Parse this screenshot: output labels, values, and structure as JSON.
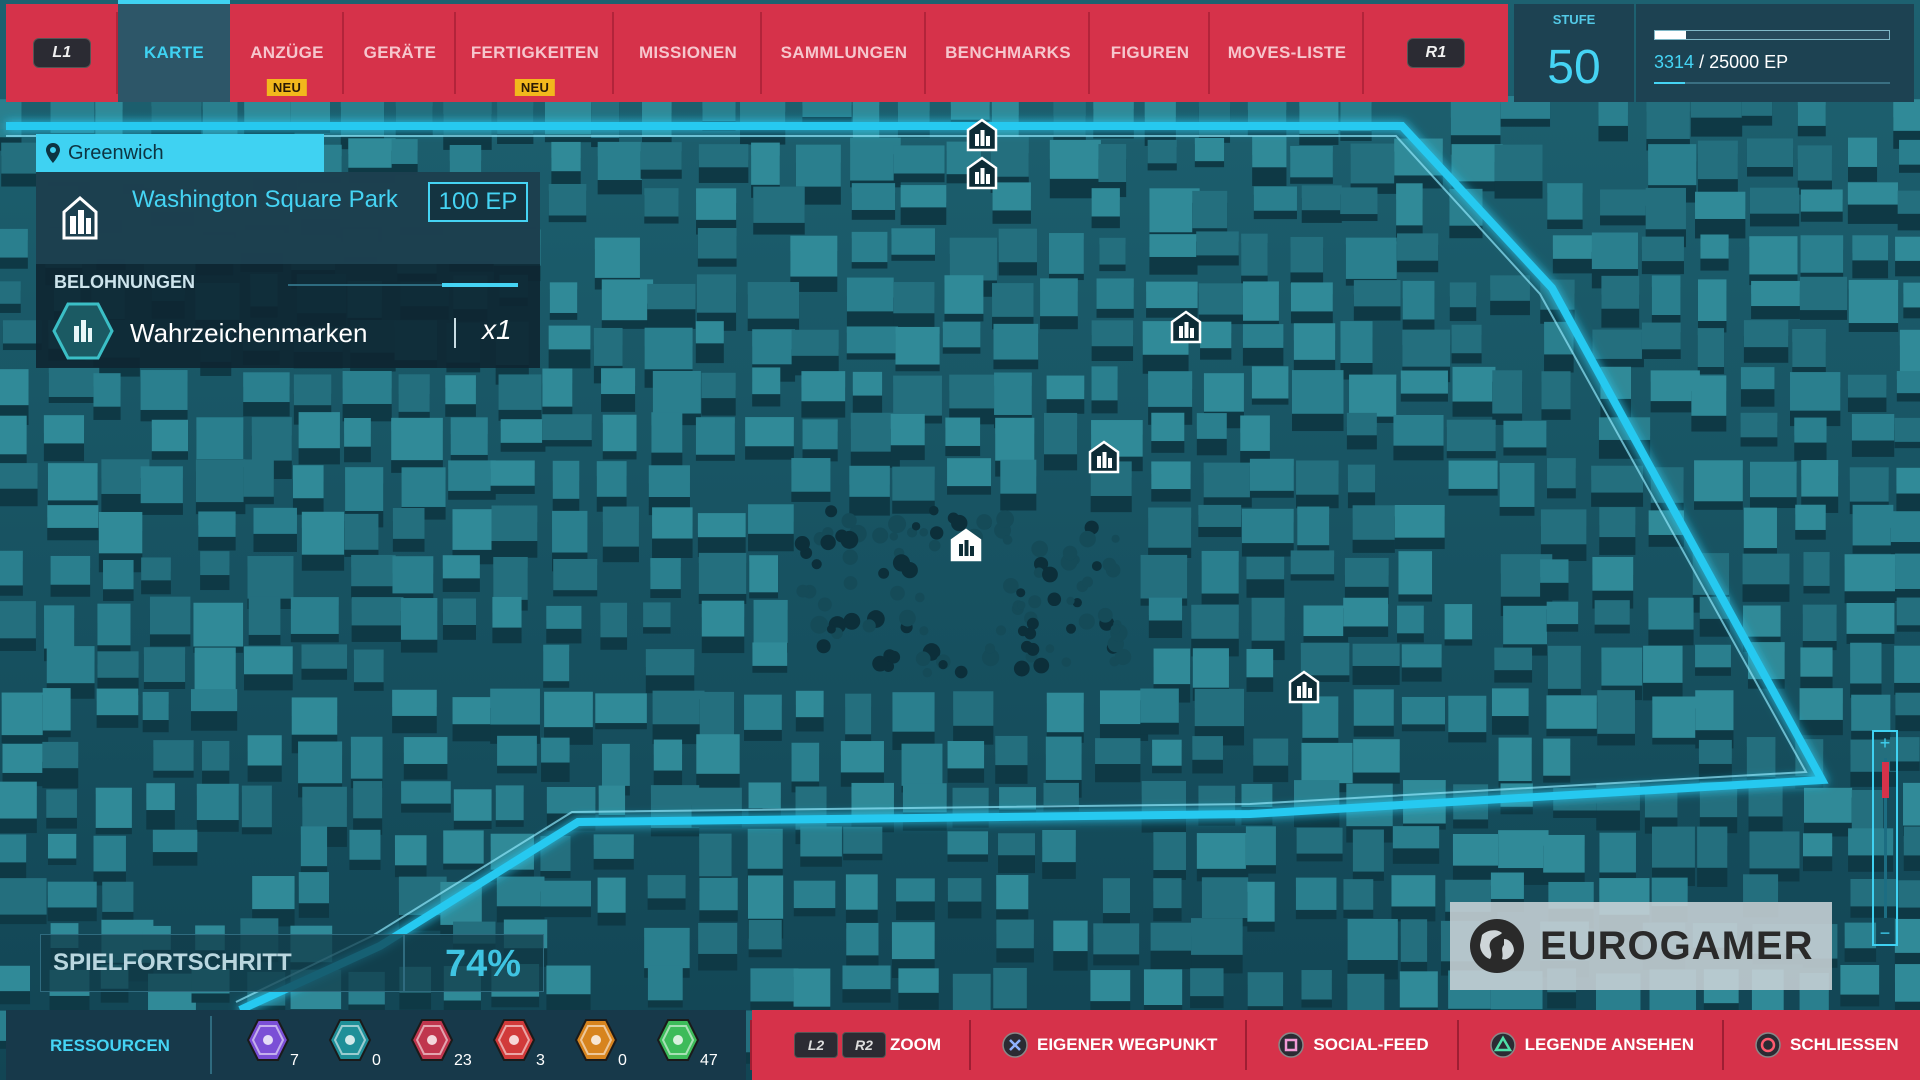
{
  "topbar": {
    "left_button": "L1",
    "right_button": "R1",
    "tabs": [
      {
        "label": "KARTE",
        "active": true,
        "badge": ""
      },
      {
        "label": "ANZÜGE",
        "active": false,
        "badge": "NEU"
      },
      {
        "label": "GERÄTE",
        "active": false,
        "badge": ""
      },
      {
        "label": "FERTIGKEITEN",
        "active": false,
        "badge": "NEU"
      },
      {
        "label": "MISSIONEN",
        "active": false,
        "badge": ""
      },
      {
        "label": "SAMMLUNGEN",
        "active": false,
        "badge": ""
      },
      {
        "label": "BENCHMARKS",
        "active": false,
        "badge": ""
      },
      {
        "label": "FIGUREN",
        "active": false,
        "badge": ""
      },
      {
        "label": "MOVES-LISTE",
        "active": false,
        "badge": ""
      }
    ]
  },
  "level": {
    "label": "STUFE",
    "value": "50",
    "xp_current": "3314",
    "xp_total": "/ 25000 EP",
    "xp_fraction": 0.1326
  },
  "location": {
    "district": "Greenwich",
    "landmark_name": "Washington Square Park",
    "xp_reward": "100 EP",
    "rewards_label": "BELOHNUNGEN",
    "reward_item": "Wahrzeichenmarken",
    "reward_quantity": "x1"
  },
  "progress": {
    "label": "SPIELFORTSCHRITT",
    "percent": "74%"
  },
  "watermark": {
    "text": "EUROGAMER"
  },
  "resources": {
    "label": "RESSOURCEN",
    "items": [
      {
        "icon": "research-token-icon",
        "color": "#7b4fd6",
        "count": "7"
      },
      {
        "icon": "landmark-token-icon",
        "color": "#1f8f98",
        "count": "0"
      },
      {
        "icon": "backpack-token-icon",
        "color": "#c0364e",
        "count": "23"
      },
      {
        "icon": "crime-token-icon",
        "color": "#d13a3a",
        "count": "3"
      },
      {
        "icon": "challenge-token-icon",
        "color": "#d7841e",
        "count": "0"
      },
      {
        "icon": "base-token-icon",
        "color": "#3dbb5a",
        "count": "47"
      }
    ]
  },
  "controls": {
    "zoom_l": "L2",
    "zoom_r": "R2",
    "zoom": "ZOOM",
    "waypoint": "EIGENER WEGPUNKT",
    "social": "SOCIAL-FEED",
    "legend": "LEGENDE ANSEHEN",
    "close": "SCHLIESSEN"
  },
  "colors": {
    "accent_cyan": "#3fd2f2",
    "menu_red": "#d6324a",
    "badge_yellow": "#f2b81c"
  }
}
